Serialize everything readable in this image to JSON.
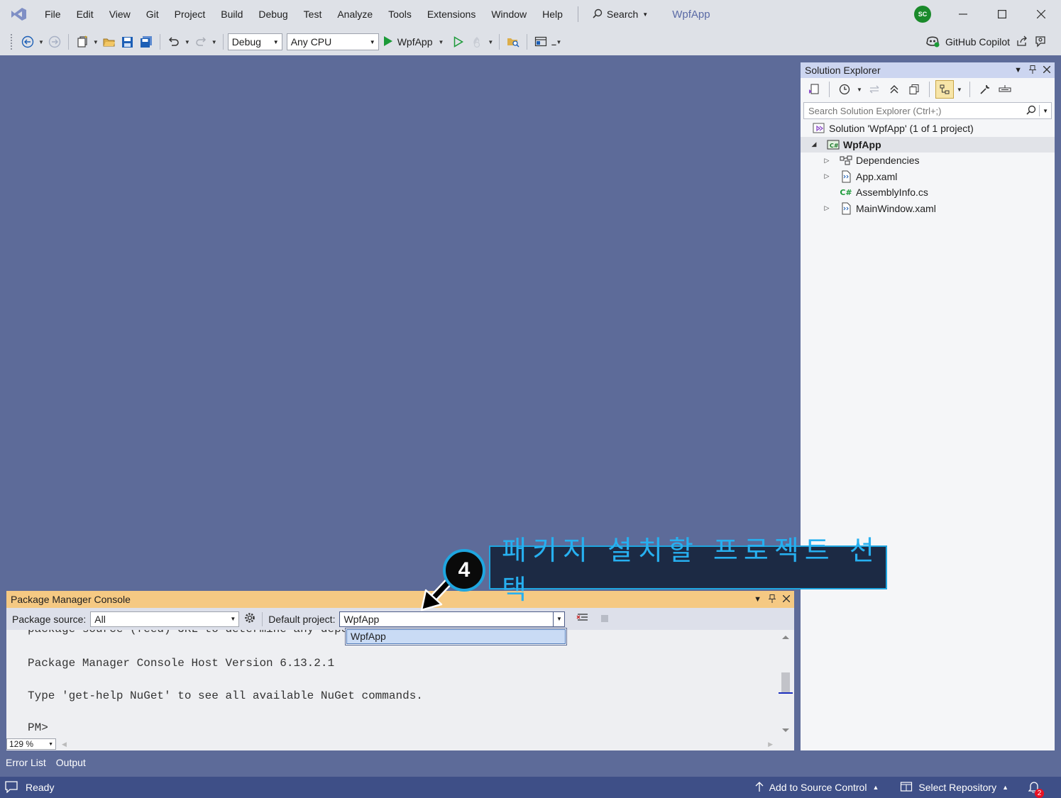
{
  "menu": {
    "items": [
      "File",
      "Edit",
      "View",
      "Git",
      "Project",
      "Build",
      "Debug",
      "Test",
      "Analyze",
      "Tools",
      "Extensions",
      "Window",
      "Help"
    ],
    "search_label": "Search",
    "solution_name": "WpfApp",
    "account_initials": "SC"
  },
  "toolbar": {
    "configuration": "Debug",
    "platform": "Any CPU",
    "run_target": "WpfApp",
    "copilot_label": "GitHub Copilot"
  },
  "solution_explorer": {
    "title": "Solution Explorer",
    "search_placeholder": "Search Solution Explorer (Ctrl+;)",
    "solution_label": "Solution 'WpfApp' (1 of 1 project)",
    "project": "WpfApp",
    "items": [
      {
        "label": "Dependencies",
        "expandable": true,
        "icon": "dependencies-icon"
      },
      {
        "label": "App.xaml",
        "expandable": true,
        "icon": "xaml-file-icon"
      },
      {
        "label": "AssemblyInfo.cs",
        "expandable": false,
        "icon": "csharp-file-icon"
      },
      {
        "label": "MainWindow.xaml",
        "expandable": true,
        "icon": "xaml-file-icon"
      }
    ]
  },
  "callout": {
    "step": "4",
    "text": "패키지 설치할 프로젝트 선택",
    "accent": "#1fa6e0"
  },
  "pmc": {
    "title": "Package Manager Console",
    "source_label": "Package source:",
    "source_value": "All",
    "project_label": "Default project:",
    "project_value": "WpfApp",
    "dropdown_options": [
      "WpfApp"
    ],
    "lines": [
      "package source (feed) URL to determine any depend",
      "Package Manager Console Host Version 6.13.2.1",
      "Type 'get-help NuGet' to see all available NuGet commands.",
      "PM>"
    ],
    "zoom": "129 %"
  },
  "bottom_tabs": [
    "Error List",
    "Output"
  ],
  "status": {
    "left": "Ready",
    "source_control": "Add to Source Control",
    "repository": "Select Repository",
    "notifications": "2"
  },
  "colors": {
    "background": "#5d6b99",
    "statusbar": "#3e4f87",
    "pmc_header": "#f5c983",
    "se_header": "#ccd5f0"
  }
}
